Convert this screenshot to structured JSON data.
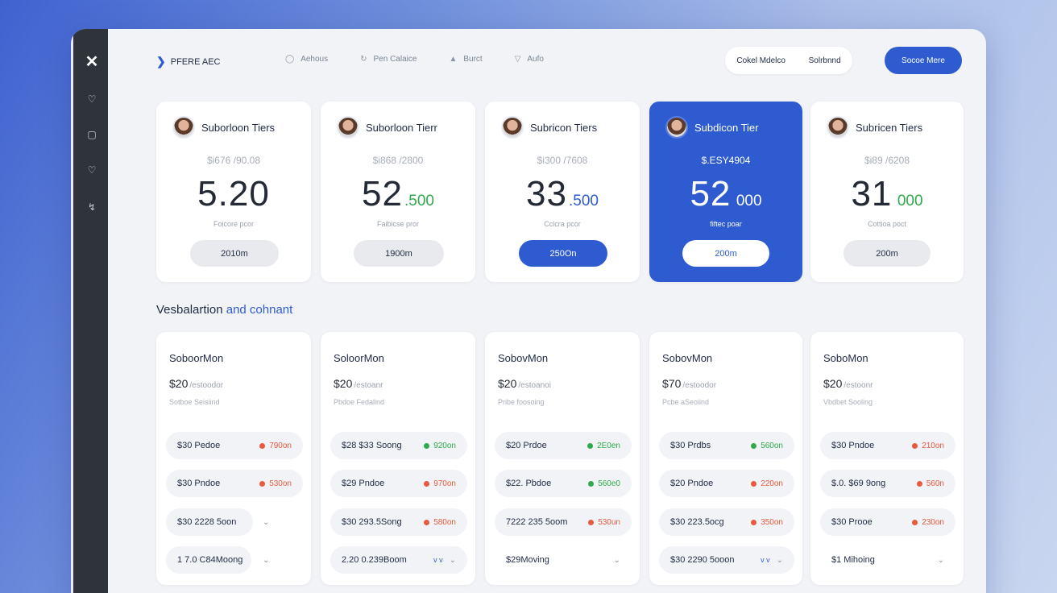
{
  "rail": {
    "items": [
      "logo-icon",
      "bell-icon",
      "box-icon",
      "heart-icon",
      "flag-icon"
    ]
  },
  "header": {
    "brand": "PFERE AEC",
    "nav": [
      {
        "label": "Aehous",
        "icon": "user-icon"
      },
      {
        "label": "Pen Calaice",
        "icon": "refresh-icon"
      },
      {
        "label": "Burct",
        "icon": "pin-icon"
      },
      {
        "label": "Aufo",
        "icon": "shield-icon"
      }
    ],
    "toggle": [
      "Cokel Mdelco",
      "Solrbnnd"
    ],
    "cta": "Socoe Mere"
  },
  "tiers": [
    {
      "name": "Suborloon Tiers",
      "old": "$i676 /90.08",
      "big": "5.20",
      "cents": "",
      "per": "Foicore pcor",
      "button": "2010m"
    },
    {
      "name": "Suborloon Tierr",
      "old": "$i868 /2800",
      "big": "52",
      "cents": ".500",
      "per": "Faibicse pror",
      "button": "1900m"
    },
    {
      "name": "Subricon Tiers",
      "old": "$i300 /7608",
      "big": "33",
      "cents": ".500",
      "per": "Cclcra pcor",
      "button": "250On"
    },
    {
      "name": "Subdicon Tier",
      "old": "$.ESY4904",
      "big": "52",
      "cents": "000",
      "per": "fiftec poar",
      "button": "200m"
    },
    {
      "name": "Subricen Tiers",
      "old": "$i89 /6208",
      "big": "31",
      "cents": "000",
      "per": "Cottioa poct",
      "button": "200m"
    }
  ],
  "section": {
    "title": "Vesbalartion",
    "accent": "and cohnant"
  },
  "plans": [
    {
      "name": "SoboorMon",
      "price": "$20",
      "unit": "/estoodor",
      "sub": "Sotboe Seisiind",
      "rows": [
        {
          "label": "$30 Pedoe",
          "value": "790on",
          "status": "red"
        },
        {
          "label": "$30 Pndoe",
          "value": "530on",
          "status": "red"
        },
        {
          "label": "$30 2228 5oon"
        },
        {
          "label": "1 7.0 C84Moong"
        }
      ]
    },
    {
      "name": "SoloorMon",
      "price": "$20",
      "unit": "/estoanr",
      "sub": "Pbdoe Fedalind",
      "rows": [
        {
          "label": "$28 $33 Soong",
          "value": "920on",
          "status": "green"
        },
        {
          "label": "$29 Pndoe",
          "value": "970on",
          "status": "red"
        },
        {
          "label": "$30 293.5Song",
          "value": "580on",
          "status": "red"
        },
        {
          "label": "2.20 0.239Boom",
          "extra": "v v"
        }
      ]
    },
    {
      "name": "SobovMon",
      "price": "$20",
      "unit": "/estoanoi",
      "sub": "Pribe foosoing",
      "rows": [
        {
          "label": "$20 Prdoe",
          "value": "2E0en",
          "status": "green"
        },
        {
          "label": "$22. Pbdoe",
          "value": "560e0",
          "status": "green"
        },
        {
          "label": "7222 235 5oom",
          "value": "530un",
          "status": "red"
        },
        {
          "label": "$29Moving"
        }
      ]
    },
    {
      "name": "SobovMon",
      "price": "$70",
      "unit": "/estoodor",
      "sub": "Pcbe aSeoiind",
      "rows": [
        {
          "label": "$30 Prdbs",
          "value": "560on",
          "status": "green"
        },
        {
          "label": "$20 Pndoe",
          "value": "220on",
          "status": "red"
        },
        {
          "label": "$30 223.5ocg",
          "value": "350on",
          "status": "red"
        },
        {
          "label": "$30 2290 5ooon",
          "extra": "v v"
        }
      ]
    },
    {
      "name": "SoboMon",
      "price": "$20",
      "unit": "/estoonr",
      "sub": "Vbdbet Sooling",
      "rows": [
        {
          "label": "$30 Pndoe",
          "value": "210on",
          "status": "red"
        },
        {
          "label": "$.0. $69 9ong",
          "value": "560n",
          "status": "red"
        },
        {
          "label": "$30 Prooe",
          "value": "230on",
          "status": "red"
        },
        {
          "label": "$1 Mihoing"
        }
      ]
    }
  ]
}
